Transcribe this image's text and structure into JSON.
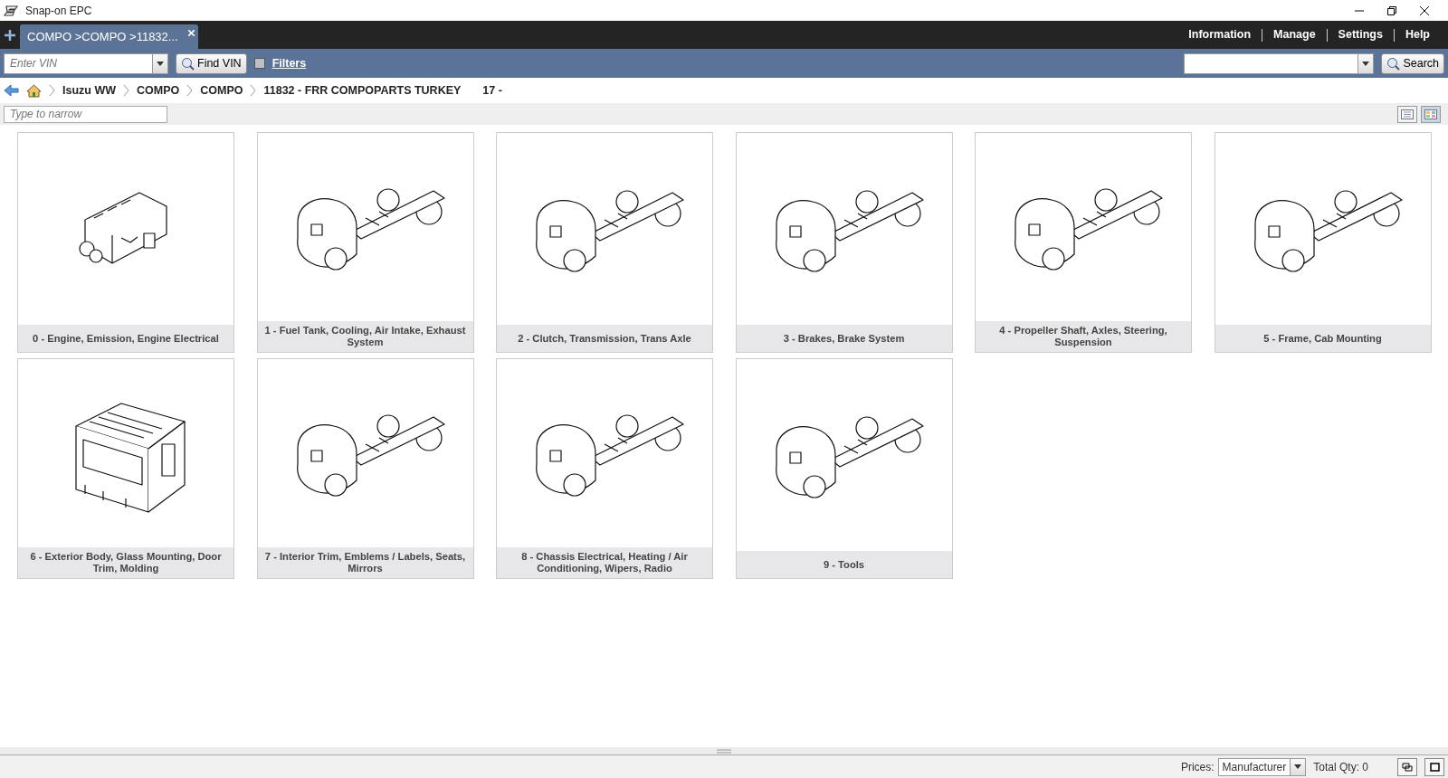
{
  "window": {
    "title": "Snap-on EPC"
  },
  "tabs": [
    {
      "label": "COMPO >COMPO >11832...",
      "selected": true
    }
  ],
  "top_menu": [
    "Information",
    "Manage",
    "Settings",
    "Help"
  ],
  "toolbar": {
    "vin_placeholder": "Enter VIN",
    "find_vin": "Find VIN",
    "filters_checked": false,
    "filters": "Filters",
    "search_button": "Search"
  },
  "breadcrumb": [
    "Isuzu WW",
    "COMPO",
    "COMPO",
    "11832 - FRR COMPOPARTS TURKEY",
    "17 -"
  ],
  "narrow": {
    "placeholder": "Type to narrow"
  },
  "view_modes": [
    {
      "kind": "list",
      "selected": false
    },
    {
      "kind": "grid",
      "selected": true
    }
  ],
  "categories": [
    {
      "label": "0 - Engine, Emission, Engine Electrical",
      "kind": "engine"
    },
    {
      "label": "1 - Fuel Tank, Cooling, Air Intake, Exhaust System",
      "kind": "chassis"
    },
    {
      "label": "2 - Clutch, Transmission, Trans Axle",
      "kind": "chassis"
    },
    {
      "label": "3 - Brakes, Brake System",
      "kind": "chassis"
    },
    {
      "label": "4 - Propeller Shaft, Axles, Steering, Suspension",
      "kind": "chassis"
    },
    {
      "label": "5 - Frame, Cab Mounting",
      "kind": "chassis"
    },
    {
      "label": "6 - Exterior Body, Glass Mounting, Door Trim, Molding",
      "kind": "cab"
    },
    {
      "label": "7 - Interior Trim, Emblems / Labels, Seats, Mirrors",
      "kind": "chassis"
    },
    {
      "label": "8 - Chassis Electrical, Heating / Air Conditioning, Wipers, Radio",
      "kind": "chassis"
    },
    {
      "label": "9 - Tools",
      "kind": "chassis"
    }
  ],
  "status_bar": {
    "prices_label": "Prices:",
    "prices_value": "Manufacturer",
    "total_qty": "Total Qty: 0"
  }
}
